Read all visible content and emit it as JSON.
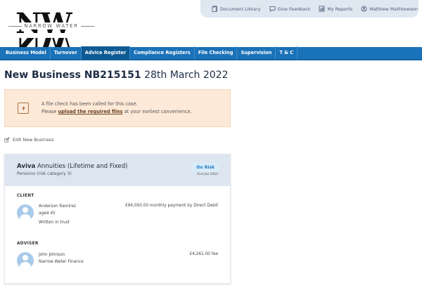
{
  "topbar": {
    "links": [
      {
        "label": "Document Library",
        "icon": "document-library-icon"
      },
      {
        "label": "Give Feedback",
        "icon": "feedback-icon"
      },
      {
        "label": "My Reports",
        "icon": "reports-icon"
      },
      {
        "label": "Matthew Matthewson",
        "icon": "user-icon"
      }
    ]
  },
  "logo": {
    "letters": "NW",
    "text": "NARROW WATER"
  },
  "nav": {
    "items": [
      {
        "label": "Business Model"
      },
      {
        "label": "Turnover"
      },
      {
        "label": "Advice Register",
        "active": true
      },
      {
        "label": "Compliance Registers"
      },
      {
        "label": "File Checking"
      },
      {
        "label": "Supervision"
      },
      {
        "label": "T & C"
      }
    ]
  },
  "page": {
    "title_bold": "New Business NB215151",
    "title_date": "28th March 2022"
  },
  "alert": {
    "line1": "A file check has been called for this case.",
    "line2_prefix": "Please",
    "line2_link": "upload the required files",
    "line2_suffix": "at your earliest convenience."
  },
  "edit_link": "Edit New Business",
  "card": {
    "provider": "Aviva",
    "product": "Annuities (Lifetime and Fixed)",
    "category": "Pensions (risk category 3)",
    "status": "On Risk",
    "status_date": "31st Jan 2022",
    "client": {
      "label": "CLIENT",
      "name": "Anderson Ramirez",
      "age": "aged 45",
      "note": "Written in trust",
      "payment": "£94,093.00 monthly payment by Direct Debit"
    },
    "adviser": {
      "label": "ADVISER",
      "name": "John Johnson",
      "firm": "Narrow Water Finance",
      "fee": "£4,261.00 fee"
    }
  },
  "colors": {
    "nav_bg": "#1a72b8",
    "alert_bg": "#fde9d7",
    "card_head_bg": "#dde5f0",
    "badge_text": "#1f76c4"
  }
}
